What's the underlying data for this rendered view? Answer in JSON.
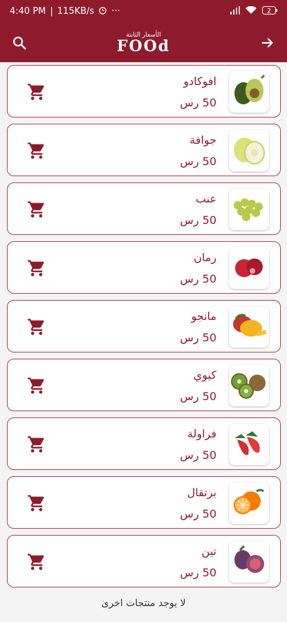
{
  "status_bar": {
    "time": "4:40 PM",
    "speed": "115KB/s",
    "battery": "2"
  },
  "header": {
    "brand_top": "الأسعار الثابتة",
    "brand_main": "FOOd"
  },
  "products": [
    {
      "name": "افوكادو",
      "price": "50 رس",
      "image": "avocado"
    },
    {
      "name": "جوافة",
      "price": "50 رس",
      "image": "guava"
    },
    {
      "name": "عنب",
      "price": "50 رس",
      "image": "grapes"
    },
    {
      "name": "رمان",
      "price": "50 رس",
      "image": "pomegranate"
    },
    {
      "name": "مانجو",
      "price": "50 رس",
      "image": "mango"
    },
    {
      "name": "كيوي",
      "price": "50 رس",
      "image": "kiwi"
    },
    {
      "name": "فراولة",
      "price": "50 رس",
      "image": "strawberry"
    },
    {
      "name": "برتقال",
      "price": "50 رس",
      "image": "orange"
    },
    {
      "name": "تين",
      "price": "50 رس",
      "image": "fig"
    }
  ],
  "footer": {
    "message": "لا يوجد منتجات اخرى"
  },
  "colors": {
    "primary": "#8e1b2c",
    "card_border": "#b0404f"
  }
}
